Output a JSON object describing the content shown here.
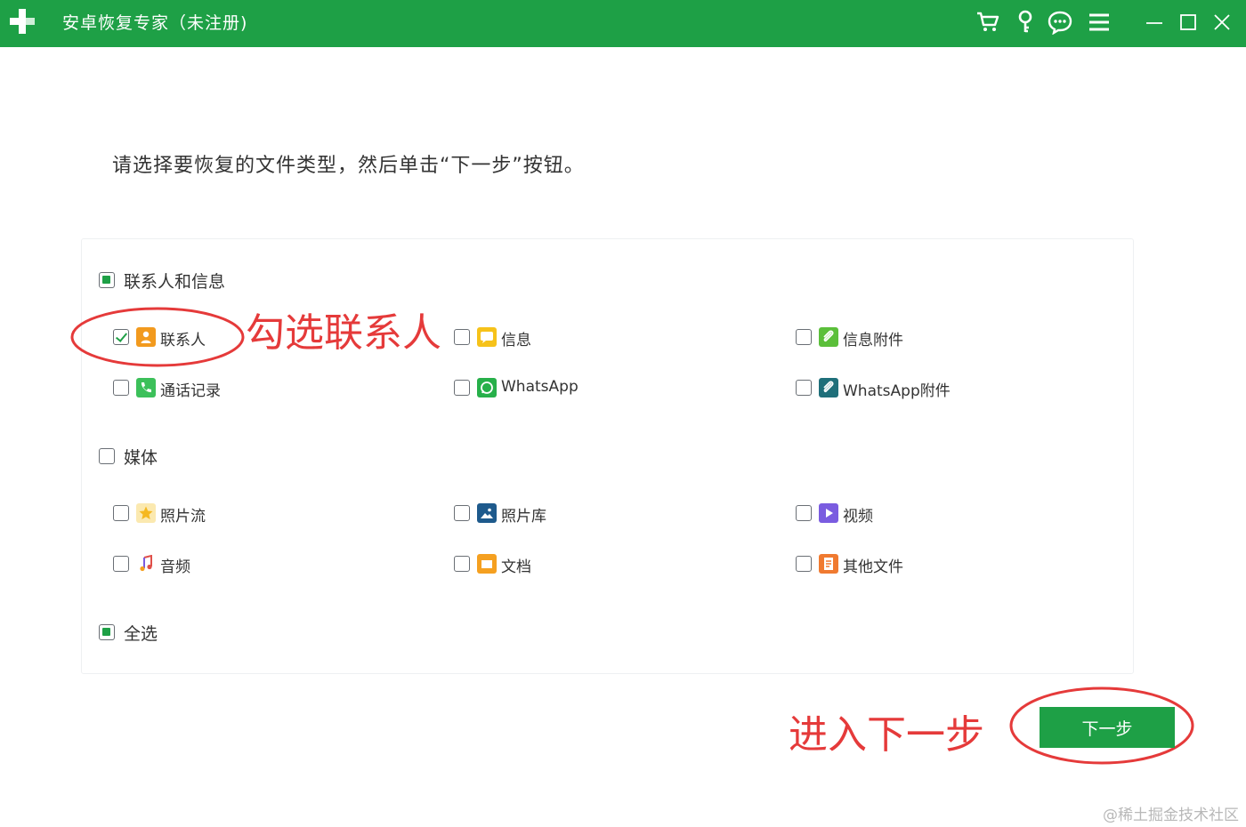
{
  "window": {
    "title": "安卓恢复专家（未注册)",
    "icons": [
      "plus-logo",
      "cart-icon",
      "key-icon",
      "chat-icon",
      "menu-icon",
      "minimize-icon",
      "maximize-icon",
      "close-icon"
    ],
    "accent_color": "#1ea046"
  },
  "main": {
    "instruction": "请选择要恢复的文件类型，然后单击“下一步”按钮。",
    "groups": [
      {
        "label": "联系人和信息",
        "state": "partial",
        "items": [
          {
            "label": "联系人",
            "checked": true,
            "icon": "contacts-icon",
            "icon_color": "#f29a1e"
          },
          {
            "label": "信息",
            "checked": false,
            "icon": "message-icon",
            "icon_color": "#f6c21a"
          },
          {
            "label": "信息附件",
            "checked": false,
            "icon": "attachment-icon",
            "icon_color": "#5bbf3a"
          },
          {
            "label": "通话记录",
            "checked": false,
            "icon": "phone-icon",
            "icon_color": "#3cc05a"
          },
          {
            "label": "WhatsApp",
            "checked": false,
            "icon": "whatsapp-icon",
            "icon_color": "#27b04a"
          },
          {
            "label": "WhatsApp附件",
            "checked": false,
            "icon": "whatsapp-attachment-icon",
            "icon_color": "#1f6f7a"
          }
        ]
      },
      {
        "label": "媒体",
        "state": "unchecked",
        "items": [
          {
            "label": "照片流",
            "checked": false,
            "icon": "photostream-icon",
            "icon_color": "#f5b820"
          },
          {
            "label": "照片库",
            "checked": false,
            "icon": "photo-library-icon",
            "icon_color": "#1e5a8c"
          },
          {
            "label": "视频",
            "checked": false,
            "icon": "video-icon",
            "icon_color": "#7a5ce0"
          },
          {
            "label": "音频",
            "checked": false,
            "icon": "audio-icon",
            "icon_color": "#e0504a"
          },
          {
            "label": "文档",
            "checked": false,
            "icon": "document-icon",
            "icon_color": "#f5a020"
          },
          {
            "label": "其他文件",
            "checked": false,
            "icon": "other-files-icon",
            "icon_color": "#f07a30"
          }
        ]
      }
    ],
    "select_all": {
      "label": "全选",
      "state": "partial"
    }
  },
  "annotations": {
    "contacts_hint": "勾选联系人",
    "next_hint": "进入下一步",
    "color": "#e53a3a"
  },
  "footer": {
    "next_label": "下一步",
    "watermark": "@稀土掘金技术社区"
  }
}
